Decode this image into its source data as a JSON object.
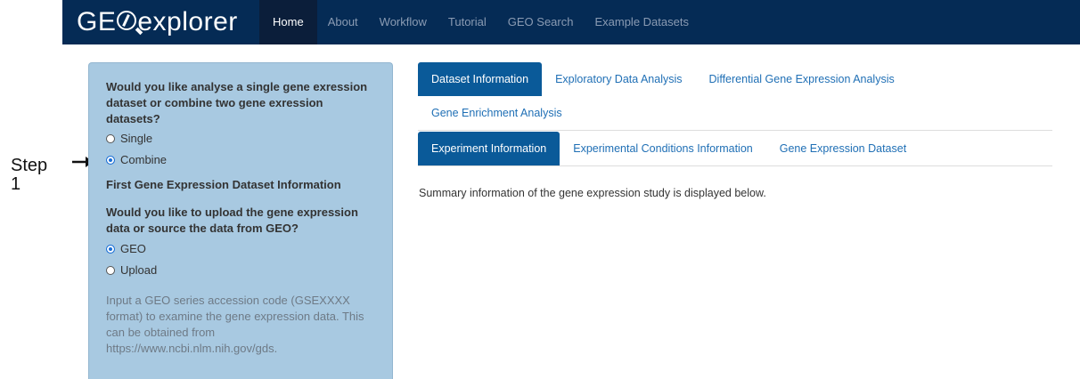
{
  "annotation": {
    "step_line1": "Step",
    "step_line2": "1"
  },
  "navbar": {
    "brand_left": "GE",
    "brand_right": "explorer",
    "links": [
      "Home",
      "About",
      "Workflow",
      "Tutorial",
      "GEO Search",
      "Example Datasets"
    ],
    "active": "Home"
  },
  "sidebar": {
    "q1": "Would you like analyse a single gene exression dataset or combine two gene exression datasets?",
    "q1_options": [
      "Single",
      "Combine"
    ],
    "q1_selected": "Combine",
    "section_title": "First Gene Expression Dataset Information",
    "q2": "Would you like to upload the gene expression data or source the data from GEO?",
    "q2_options": [
      "GEO",
      "Upload"
    ],
    "q2_selected": "GEO",
    "help": "Input a GEO series accession code (GSEXXXX format) to examine the gene expression data. This can be obtained from https://www.ncbi.nlm.nih.gov/gds."
  },
  "main_tabs": {
    "row1": [
      "Dataset Information",
      "Exploratory Data Analysis",
      "Differential Gene Expression Analysis"
    ],
    "row2": [
      "Gene Enrichment Analysis"
    ],
    "active": "Dataset Information"
  },
  "sub_tabs": {
    "items": [
      "Experiment Information",
      "Experimental Conditions Information",
      "Gene Expression Dataset"
    ],
    "active": "Experiment Information"
  },
  "summary_text": "Summary information of the gene expression study is displayed below."
}
